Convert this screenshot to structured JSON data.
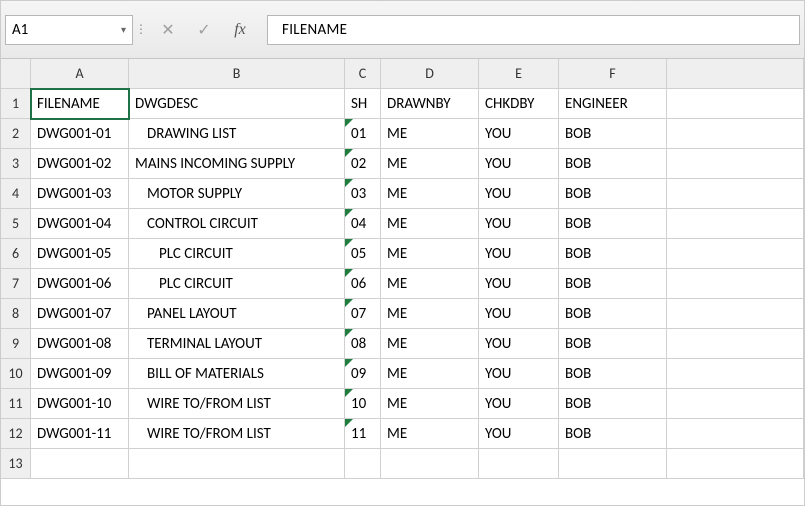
{
  "name_box": {
    "value": "A1"
  },
  "formula_bar": {
    "value": "FILENAME"
  },
  "icons": {
    "dropdown": "▾",
    "divider": "⋮",
    "cancel": "✕",
    "enter": "✓",
    "fx": "fx"
  },
  "columns": [
    "A",
    "B",
    "C",
    "D",
    "E",
    "F"
  ],
  "row_numbers": [
    "1",
    "2",
    "3",
    "4",
    "5",
    "6",
    "7",
    "8",
    "9",
    "10",
    "11",
    "12",
    "13"
  ],
  "chart_data": {
    "type": "table",
    "title": "Drawing register",
    "columns": [
      "FILENAME",
      "DWGDESC",
      "SH",
      "DRAWNBY",
      "CHKDBY",
      "ENGINEER"
    ],
    "rows": [
      [
        "DWG001-01",
        "DRAWING LIST",
        "01",
        "ME",
        "YOU",
        "BOB"
      ],
      [
        "DWG001-02",
        "MAINS INCOMING SUPPLY",
        "02",
        "ME",
        "YOU",
        "BOB"
      ],
      [
        "DWG001-03",
        "MOTOR SUPPLY",
        "03",
        "ME",
        "YOU",
        "BOB"
      ],
      [
        "DWG001-04",
        "CONTROL CIRCUIT",
        "04",
        "ME",
        "YOU",
        "BOB"
      ],
      [
        "DWG001-05",
        "PLC CIRCUIT",
        "05",
        "ME",
        "YOU",
        "BOB"
      ],
      [
        "DWG001-06",
        "PLC CIRCUIT",
        "06",
        "ME",
        "YOU",
        "BOB"
      ],
      [
        "DWG001-07",
        "PANEL LAYOUT",
        "07",
        "ME",
        "YOU",
        "BOB"
      ],
      [
        "DWG001-08",
        "TERMINAL LAYOUT",
        "08",
        "ME",
        "YOU",
        "BOB"
      ],
      [
        "DWG001-09",
        "BILL OF MATERIALS",
        "09",
        "ME",
        "YOU",
        "BOB"
      ],
      [
        "DWG001-10",
        "WIRE TO/FROM LIST",
        "10",
        "ME",
        "YOU",
        "BOB"
      ],
      [
        "DWG001-11",
        "WIRE TO/FROM LIST",
        "11",
        "ME",
        "YOU",
        "BOB"
      ]
    ]
  },
  "indent": {
    "B2": "indent1",
    "B4": "indent1",
    "B5": "indent1",
    "B6": "indent2",
    "B7": "indent2",
    "B8": "indent1",
    "B9": "indent1",
    "B10": "indent1",
    "B11": "indent1",
    "B12": "indent1"
  }
}
